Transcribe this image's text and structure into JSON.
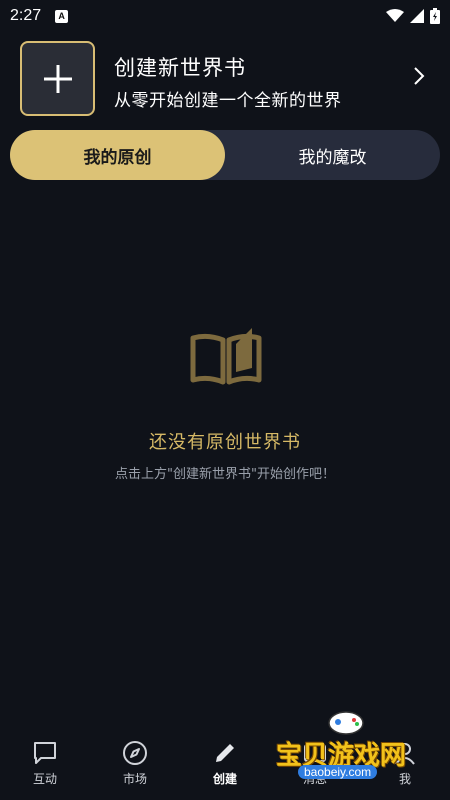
{
  "status_bar": {
    "time": "2:27",
    "notif_letter": "A"
  },
  "create_card": {
    "title": "创建新世界书",
    "subtitle": "从零开始创建一个全新的世界"
  },
  "tabs": [
    {
      "label": "我的原创",
      "active": true
    },
    {
      "label": "我的魔改",
      "active": false
    }
  ],
  "empty_state": {
    "icon": "open-book-icon",
    "title": "还没有原创世界书",
    "hint": "点击上方\"创建新世界书\"开始创作吧！"
  },
  "bottom_nav": [
    {
      "label": "互动",
      "icon": "chat-bubble-icon"
    },
    {
      "label": "市场",
      "icon": "compass-icon"
    },
    {
      "label": "创建",
      "icon": "pencil-icon",
      "active": true
    },
    {
      "label": "消息",
      "icon": "message-icon"
    },
    {
      "label": "我",
      "icon": "person-icon"
    }
  ],
  "watermark": {
    "text": "宝贝游戏网",
    "url": "baobeiy.com"
  },
  "colors": {
    "background": "#0f1219",
    "accent_gold": "#dcc276",
    "tab_track": "#272c3c",
    "empty_title": "#d6b966"
  }
}
